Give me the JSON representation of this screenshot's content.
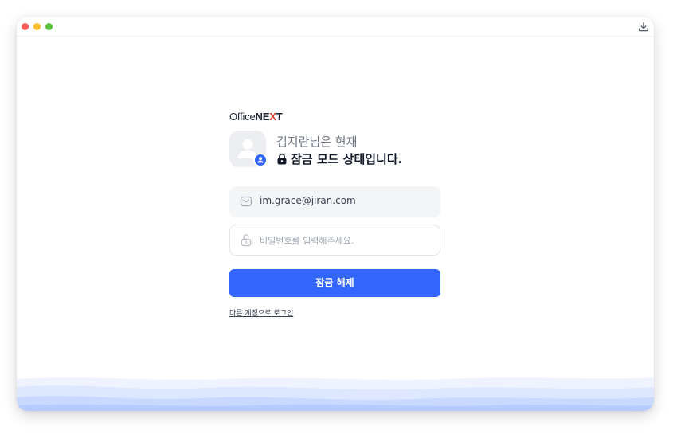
{
  "window": {
    "controls": [
      "close",
      "minimize",
      "maximize"
    ],
    "download_icon": "download-icon"
  },
  "brand": {
    "logo_prefix": "Office",
    "logo_next_a": "NE",
    "logo_next_x": "X",
    "logo_next_b": "T",
    "accent_color": "#e63a2e"
  },
  "lock_screen": {
    "greeting": "김지란님은 현재",
    "status": "잠금 모드 상태입니다.",
    "status_icon": "lock-icon",
    "avatar_icon": "user-icon"
  },
  "form": {
    "email_value": "im.grace@jiran.com",
    "email_icon": "mail-icon",
    "password_placeholder": "비밀번호를 입력해주세요.",
    "password_icon": "unlock-icon",
    "submit_label": "잠금 해제",
    "other_account_link": "다른 계정으로 로그인"
  },
  "colors": {
    "primary": "#3366ff",
    "wave_light": "#e7eeff",
    "wave_mid": "#d2dfff",
    "wave_dark": "#b9ceff"
  }
}
